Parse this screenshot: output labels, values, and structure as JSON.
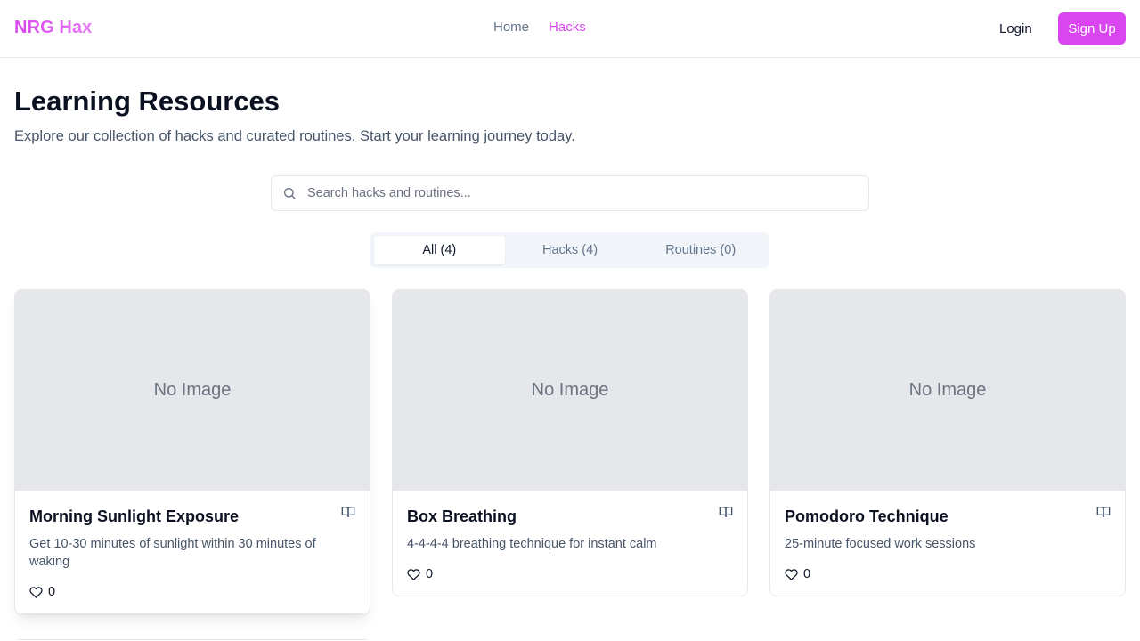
{
  "nav": {
    "brand": "NRG Hax",
    "links": [
      {
        "label": "Home"
      },
      {
        "label": "Hacks"
      }
    ],
    "login_label": "Login",
    "signup_label": "Sign Up"
  },
  "header": {
    "title": "Learning Resources",
    "subtitle": "Explore our collection of hacks and curated routines. Start your learning journey today."
  },
  "search": {
    "placeholder": "Search hacks and routines...",
    "value": ""
  },
  "tabs": [
    {
      "label": "All (4)",
      "active": true
    },
    {
      "label": "Hacks (4)",
      "active": false
    },
    {
      "label": "Routines (0)",
      "active": false
    }
  ],
  "cards": [
    {
      "image_text": "No Image",
      "title": "Morning Sunlight Exposure",
      "description": "Get 10-30 minutes of sunlight within 30 minutes of waking",
      "likes": "0",
      "icon": "book-open-icon"
    },
    {
      "image_text": "No Image",
      "title": "Box Breathing",
      "description": "4-4-4-4 breathing technique for instant calm",
      "likes": "0",
      "icon": "book-open-icon"
    },
    {
      "image_text": "No Image",
      "title": "Pomodoro Technique",
      "description": "25-minute focused work sessions",
      "likes": "0",
      "icon": "book-open-icon"
    }
  ],
  "colors": {
    "accent": "#d946ef",
    "muted_text": "#64748b",
    "placeholder_bg": "#e5e7eb"
  }
}
